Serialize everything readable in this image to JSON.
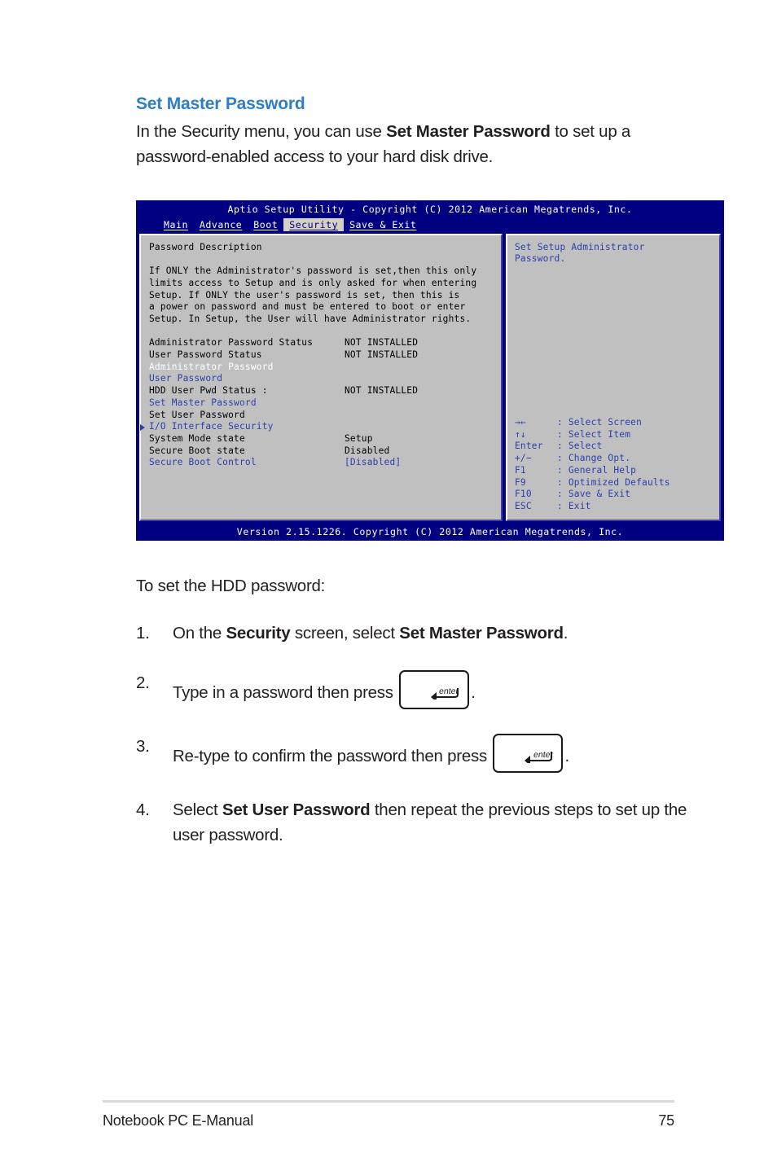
{
  "section": {
    "title": "Set Master Password",
    "intro_before": "In the Security menu, you can use ",
    "intro_bold": "Set Master Password",
    "intro_after": " to set up a password-enabled access to your hard disk drive."
  },
  "bios": {
    "title_bar": "Aptio Setup Utility - Copyright (C) 2012 American Megatrends, Inc.",
    "tabs": [
      {
        "label": "Main",
        "active": false
      },
      {
        "label": "Advance",
        "active": false
      },
      {
        "label": "Boot",
        "active": false
      },
      {
        "label": "Security",
        "active": true
      },
      {
        "label": "Save & Exit",
        "active": false
      }
    ],
    "left_pane": {
      "heading": "Password Description",
      "description": [
        "If ONLY the Administrator's password is set,then this only",
        "limits access to Setup and is only asked for when entering",
        "Setup. If ONLY the user's password is set, then this is",
        "a power on password and must be entered to boot or enter",
        "Setup. In Setup, the User will have Administrator rights."
      ],
      "items": [
        {
          "label": "Administrator Password Status",
          "value": "NOT INSTALLED",
          "color": "black"
        },
        {
          "label": "User Password Status",
          "value": "NOT INSTALLED",
          "color": "black"
        },
        {
          "label": "Administrator Password",
          "value": "",
          "color": "white"
        },
        {
          "label": "User Password",
          "value": "",
          "color": "blue"
        },
        {
          "label": "HDD User Pwd Status :",
          "value": "NOT INSTALLED",
          "color": "black"
        },
        {
          "label": "Set Master Password",
          "value": "",
          "color": "blue"
        },
        {
          "label": "Set User Password",
          "value": "",
          "color": "black"
        },
        {
          "label": "I/O Interface Security",
          "value": "",
          "color": "blue",
          "arrow": true
        },
        {
          "label": "System Mode state",
          "value": "Setup",
          "color": "black"
        },
        {
          "label": "Secure Boot state",
          "value": "Disabled",
          "color": "black"
        },
        {
          "label": "Secure Boot Control",
          "value": "[Disabled]",
          "color": "blue"
        }
      ]
    },
    "right_pane": {
      "help": [
        "Set Setup Administrator",
        "Password."
      ],
      "key_legend": [
        {
          "key": "→←",
          "desc": ": Select Screen"
        },
        {
          "key": "↑↓",
          "desc": ": Select Item"
        },
        {
          "key": "Enter",
          "desc": ": Select"
        },
        {
          "key": "+/−",
          "desc": ": Change Opt."
        },
        {
          "key": "F1",
          "desc": ": General Help"
        },
        {
          "key": "F9",
          "desc": ": Optimized Defaults"
        },
        {
          "key": "F10",
          "desc": ": Save & Exit"
        },
        {
          "key": "ESC",
          "desc": ": Exit"
        }
      ]
    },
    "version_bar": "Version 2.15.1226. Copyright (C) 2012 American Megatrends, Inc.",
    "colors": {
      "background": "#000080",
      "pane": "#c0c0c0",
      "blue_text": "#2b3faa",
      "active_tab_bg": "#d4d0c8"
    }
  },
  "steps": {
    "lead": "To set the HDD password:",
    "items": [
      {
        "num": "1.",
        "parts": [
          {
            "t": "On the ",
            "b": false
          },
          {
            "t": "Security",
            "b": true
          },
          {
            "t": " screen, select ",
            "b": false
          },
          {
            "t": "Set Master Password",
            "b": true
          },
          {
            "t": ".",
            "b": false
          }
        ]
      },
      {
        "num": "2.",
        "parts": [
          {
            "t": "Type in a password then press ",
            "b": false
          }
        ],
        "key": "enter",
        "tail": "."
      },
      {
        "num": "3.",
        "parts": [
          {
            "t": "Re-type to confirm the password then press ",
            "b": false
          }
        ],
        "key": "enter",
        "tail": "."
      },
      {
        "num": "4.",
        "parts": [
          {
            "t": "Select ",
            "b": false
          },
          {
            "t": "Set User Password",
            "b": true
          },
          {
            "t": " then repeat the previous steps to set up the user password.",
            "b": false
          }
        ]
      }
    ],
    "enter_key_label": "enter"
  },
  "footer": {
    "left": "Notebook PC E-Manual",
    "page_number": "75"
  }
}
